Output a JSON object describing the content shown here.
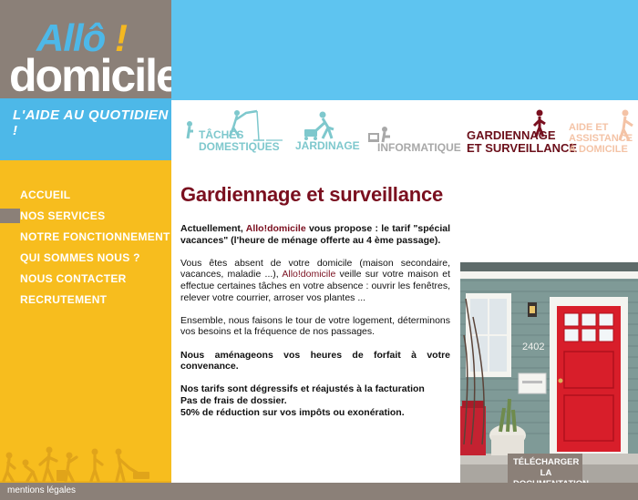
{
  "logo": {
    "allo": "Allô",
    "exclamation": "!",
    "domicile": "domicile",
    "tagline": "L'AIDE AU QUOTIDIEN !"
  },
  "services": [
    {
      "label_line1": "TÂCHES",
      "label_line2": "DOMESTIQUES",
      "icon": "cleaning-figure-icon"
    },
    {
      "label_line1": "JARDINAGE",
      "icon": "gardening-figure-icon"
    },
    {
      "label_line1": "INFORMATIQUE",
      "icon": "computer-figure-icon"
    },
    {
      "label_line1": "GARDIENNAGE",
      "label_line2": "ET SURVEILLANCE",
      "icon": "guard-figure-icon"
    },
    {
      "label_line1": "AIDE ET",
      "label_line2": "ASSISTANCE",
      "label_line3": "À DOMICILE",
      "icon": "assistance-figure-icon"
    }
  ],
  "nav": [
    {
      "label": "Accueil"
    },
    {
      "label": "Nos services"
    },
    {
      "label": "Notre fonctionnement"
    },
    {
      "label": "Qui sommes nous ?"
    },
    {
      "label": "Nous contacter"
    },
    {
      "label": "Recrutement"
    }
  ],
  "content": {
    "title": "Gardiennage et surveillance",
    "p1_a": "Actuellement, ",
    "p1_brand": "Allo!domicile",
    "p1_b": " vous propose : le tarif \"spécial vacances\" (l'heure de ménage offerte au 4 ème passage).",
    "p2_a": "Vous êtes absent de votre domicile (maison secondaire, vacances, maladie ...), ",
    "p2_brand": "Allo!domicile",
    "p2_b": " veille sur votre maison et effectue certaines tâches en votre absence : ouvrir les fenêtres, relever votre courrier, arroser vos plantes ...",
    "p3": "Ensemble, nous faisons le tour de votre logement, déterminons vos besoins et la fréquence de nos passages.",
    "p4": "Nous aménageons vos heures de forfait à votre convenance.",
    "p5_l1": "Nos tarifs sont dégressifs et réajustés à la facturation",
    "p5_l2": "Pas de frais de dossier.",
    "p5_l3": "50% de réduction sur vos impôts ou exonération."
  },
  "photo": {
    "house_number": "2402"
  },
  "download_button": {
    "line1": "Télécharger la",
    "line2": "documentation"
  },
  "footer": {
    "link": "mentions légales"
  },
  "colors": {
    "blue": "#5ec4f0",
    "yellow": "#f7bd1e",
    "taupe": "#8b8078",
    "burgundy": "#7a0f1f",
    "door_red": "#d81e2a"
  }
}
